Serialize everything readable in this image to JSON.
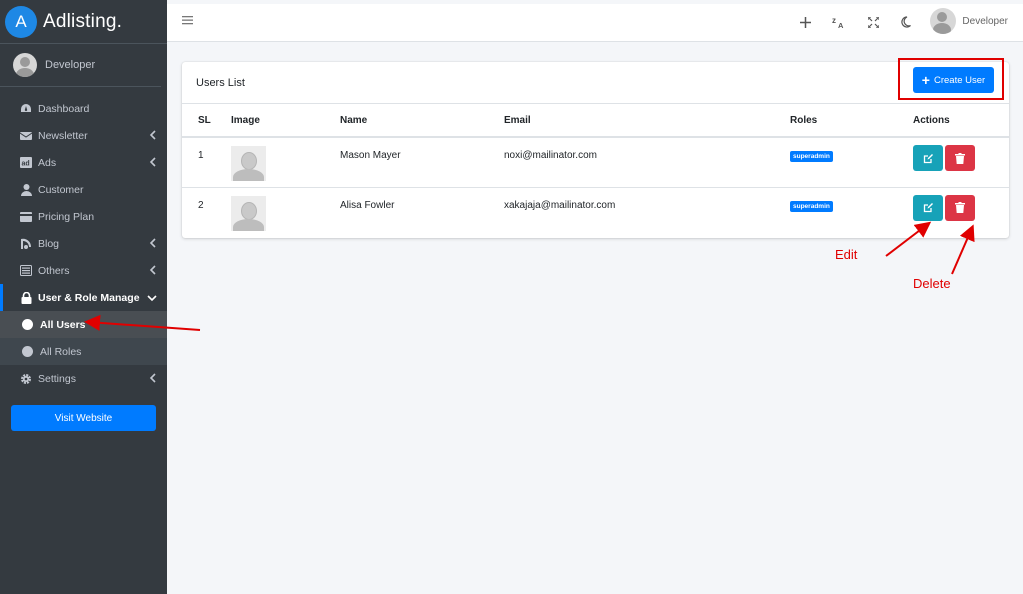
{
  "app": {
    "brand_letter": "A",
    "brand_name": "Adlisting."
  },
  "sidebar": {
    "user_name": "Developer",
    "items": [
      {
        "label": "Dashboard",
        "icon": "dashboard-icon",
        "has_children": false
      },
      {
        "label": "Newsletter",
        "icon": "envelope-icon",
        "has_children": true
      },
      {
        "label": "Ads",
        "icon": "ad-icon",
        "has_children": true
      },
      {
        "label": "Customer",
        "icon": "user-icon",
        "has_children": false
      },
      {
        "label": "Pricing Plan",
        "icon": "credit-card-icon",
        "has_children": false
      },
      {
        "label": "Blog",
        "icon": "blog-icon",
        "has_children": true
      },
      {
        "label": "Others",
        "icon": "list-icon",
        "has_children": true
      },
      {
        "label": "User & Role Manage",
        "icon": "lock-icon",
        "has_children": true,
        "open": true
      },
      {
        "label": "Settings",
        "icon": "gear-icon",
        "has_children": true
      }
    ],
    "submenu": [
      {
        "label": "All Users",
        "active": true
      },
      {
        "label": "All Roles",
        "active": false
      }
    ],
    "visit_button": "Visit Website"
  },
  "topbar": {
    "user_name": "Developer",
    "icons": [
      "plus-icon",
      "translate-icon",
      "fullscreen-icon",
      "moon-icon"
    ]
  },
  "card": {
    "title": "Users List",
    "create_button": "Create User",
    "columns": [
      "SL",
      "Image",
      "Name",
      "Email",
      "Roles",
      "Actions"
    ],
    "rows": [
      {
        "sl": "1",
        "name": "Mason Mayer",
        "email": "noxi@mailinator.com",
        "role": "superadmin"
      },
      {
        "sl": "2",
        "name": "Alisa Fowler",
        "email": "xakajaja@mailinator.com",
        "role": "superadmin"
      }
    ]
  },
  "annotations": {
    "edit": "Edit",
    "delete": "Delete"
  },
  "colors": {
    "sidebar_bg": "#343a40",
    "primary": "#007bff",
    "info": "#17a2b8",
    "danger": "#dc3545",
    "annotation": "#e00000"
  }
}
